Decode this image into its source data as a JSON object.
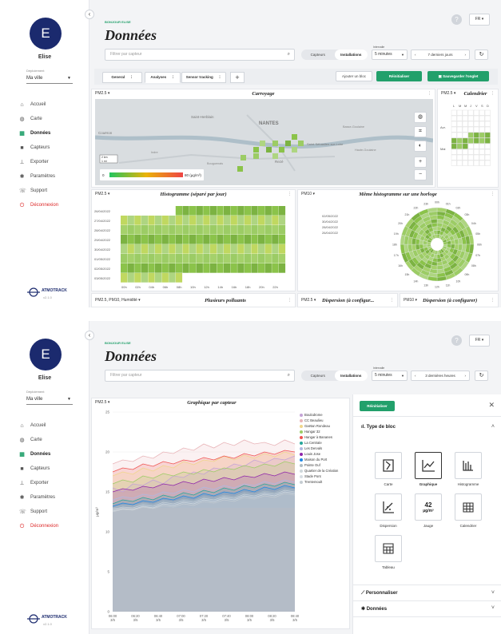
{
  "user": {
    "initial": "E",
    "name": "Elise",
    "deployment_label": "Déploiement",
    "deployment_value": "Ma ville"
  },
  "nav": [
    {
      "label": "Accueil",
      "icon": "home-icon"
    },
    {
      "label": "Carte",
      "icon": "globe-icon"
    },
    {
      "label": "Données",
      "icon": "grid-icon",
      "active": true
    },
    {
      "label": "Capteurs",
      "icon": "sensor-icon"
    },
    {
      "label": "Exporter",
      "icon": "download-icon"
    },
    {
      "label": "Paramètres",
      "icon": "gear-icon"
    },
    {
      "label": "Support",
      "icon": "support-icon"
    },
    {
      "label": "Déconnexion",
      "icon": "power-icon"
    }
  ],
  "brand": {
    "name": "ATMOTRACK",
    "version": "v2.1.0"
  },
  "header": {
    "greeting": "BONJOUR ELISE",
    "title": "Données",
    "help": "?",
    "lang": "FR ▾"
  },
  "toolbar": {
    "filter_placeholder": "Filtrer par capteur",
    "seg_sensors": "Capteurs",
    "seg_installations": "Installations",
    "interval_label": "Intervalle",
    "interval_value": "5 minutes",
    "range_1": "7 derniers jours",
    "range_2": "3 dernières heures"
  },
  "tabs": [
    {
      "label": "General"
    },
    {
      "label": "Analyses"
    },
    {
      "label": "Sensor tracking"
    }
  ],
  "actions": {
    "add_block": "Ajouter un bloc",
    "reset": "Réinitialiser",
    "save": "Sauvegarder l'onglet"
  },
  "screen1": {
    "map_panel": {
      "pollutant": "PM2.5 ▾",
      "title": "Carroyage",
      "legend_min": "0",
      "legend_max": "80 (µg/m³)",
      "scale_1": "2 km",
      "scale_2": "1 mi",
      "places": [
        "Saint-Herblain",
        "NANTES",
        "Couëron",
        "Saint-Sébastien-sur-Loire",
        "Rezé",
        "Basse-Goulaine",
        "Haute-Goulaine",
        "Bouguenais",
        "Indre"
      ]
    },
    "calendar_panel": {
      "pollutant": "PM2.5 ▾",
      "title": "Calendrier",
      "days": [
        "L",
        "M",
        "M",
        "J",
        "V",
        "S",
        "D"
      ],
      "months": [
        "Avr.",
        "Mai"
      ]
    },
    "histo_panel": {
      "pollutant": "PM2.5 ▾",
      "title": "Histogramme (séparé par jour)",
      "dates": [
        "26/04/2022",
        "27/04/2022",
        "28/04/2022",
        "29/04/2022",
        "30/04/2022",
        "01/05/2022",
        "02/05/2022",
        "03/05/2022"
      ],
      "hours": [
        "00h",
        "02h",
        "04h",
        "06h",
        "08h",
        "10h",
        "12h",
        "14h",
        "16h",
        "18h",
        "20h",
        "22h"
      ]
    },
    "clock_panel": {
      "pollutant": "PM10 ▾",
      "title": "Même histogramme sur une horloge",
      "dates": [
        "02/05/2022",
        "30/04/2022",
        "28/04/2022",
        "26/04/2022"
      ],
      "hours": [
        "22h",
        "23h",
        "00h",
        "01h",
        "02h",
        "03h",
        "04h",
        "05h",
        "06h",
        "07h",
        "08h",
        "09h",
        "10h",
        "11h",
        "12h",
        "13h",
        "14h",
        "15h",
        "16h",
        "17h",
        "18h",
        "19h",
        "20h",
        "21h"
      ]
    },
    "bottom_panels": [
      {
        "pollutant": "PM2.5, PM10, Humidité ▾",
        "title": "Plusieurs polluants"
      },
      {
        "pollutant": "PM2.5 ▾",
        "title": "Dispersion (à configur..."
      },
      {
        "pollutant": "PM10 ▾",
        "title": "Dispersion (à configurer)"
      }
    ]
  },
  "screen2": {
    "chart_panel": {
      "pollutant": "PM2.5 ▾",
      "title": "Graphique par capteur"
    },
    "side": {
      "section_type": "Type de bloc",
      "tiles": [
        {
          "label": "Carte",
          "icon": "map-icon"
        },
        {
          "label": "Graphique",
          "icon": "line-chart-icon",
          "selected": true
        },
        {
          "label": "Histogramme",
          "icon": "histogram-icon"
        },
        {
          "label": "Dispersion",
          "icon": "scatter-icon"
        },
        {
          "label": "Jauge",
          "icon": "gauge-icon",
          "value": "42",
          "unit": "µg/m³"
        },
        {
          "label": "Calendrier",
          "icon": "calendar-icon"
        },
        {
          "label": "Tableau",
          "icon": "table-icon"
        }
      ],
      "section_customize": "Personnaliser",
      "section_data": "Données"
    }
  },
  "chart_data": {
    "type": "line",
    "title": "Graphique par capteur",
    "ylabel": "µg/m³",
    "ylim": [
      0,
      25
    ],
    "yticks": [
      0,
      5,
      10,
      15,
      20,
      25
    ],
    "x": [
      "06:00\n3/5",
      "06:20\n3/5",
      "06:40\n3/5",
      "07:00\n3/5",
      "07:20\n3/5",
      "07:40\n3/5",
      "08:00\n3/5",
      "08:20\n3/5",
      "08:40\n3/5"
    ],
    "series": [
      {
        "name": "Boulodrome",
        "color": "#c4a3d6",
        "values": [
          15.5,
          15,
          16,
          15.8,
          16.5,
          16,
          17,
          16.8,
          17.5,
          17.2,
          18,
          17.8,
          18.5,
          18.2,
          19,
          18.6,
          19.2,
          19,
          19.5
        ]
      },
      {
        "name": "CC Beaulieu",
        "color": "#e8b4b8",
        "values": [
          18.5,
          19,
          18.8,
          19.5,
          19.2,
          20,
          19.8,
          20.5,
          20.2,
          21,
          20.5,
          21.2,
          20.8,
          21.5,
          21,
          21.2,
          20.8,
          21.5,
          21
        ]
      },
      {
        "name": "Gaëtan Rondeau",
        "color": "#f0d68a",
        "values": [
          17,
          17.5,
          17.2,
          18,
          17.6,
          18.3,
          18,
          18.8,
          18.4,
          19,
          18.8,
          19.5,
          19,
          19.6,
          19.2,
          19.8,
          19.4,
          20,
          19.6
        ]
      },
      {
        "name": "Hangar 32",
        "color": "#9ccc65",
        "values": [
          16,
          16.5,
          16.2,
          17,
          16.7,
          17.3,
          17,
          17.5,
          17.2,
          17.8,
          17.5,
          18,
          17.8,
          18.3,
          18,
          18.5,
          18.2,
          18.8,
          18.5
        ]
      },
      {
        "name": "Hangar à Bananes",
        "color": "#ef5350",
        "values": [
          17.5,
          18,
          17.8,
          18.5,
          18.2,
          18.8,
          18.5,
          19,
          18.8,
          19.3,
          19,
          19.5,
          19.2,
          19.8,
          19.5,
          20,
          19.7,
          20.2,
          20
        ]
      },
      {
        "name": "La Centrale",
        "color": "#26a69a",
        "values": [
          13.5,
          14,
          13.8,
          14.3,
          14,
          14.6,
          14.3,
          14.9,
          14.6,
          15.2,
          14.9,
          15.5,
          15.2,
          15.8,
          15.5,
          16,
          15.7,
          16.2,
          15.9
        ]
      },
      {
        "name": "Les Dervals",
        "color": "#b0b8e0",
        "values": [
          14,
          14.4,
          14.2,
          14.7,
          14.5,
          15,
          14.8,
          15.3,
          15,
          15.6,
          15.3,
          15.8,
          15.5,
          16,
          15.8,
          16.3,
          16,
          16.5,
          16.2
        ]
      },
      {
        "name": "Louis Jose",
        "color": "#8e24aa",
        "values": [
          15,
          15.4,
          15.2,
          15.7,
          15.5,
          16,
          15.8,
          16.3,
          16,
          16.6,
          16.3,
          16.8,
          16.5,
          17,
          16.8,
          17.3,
          17,
          17.5,
          17.2
        ]
      },
      {
        "name": "Maison du Port",
        "color": "#1e88e5",
        "values": [
          13.2,
          13.6,
          13.4,
          13.9,
          13.7,
          14.2,
          14,
          14.5,
          14.2,
          14.8,
          14.5,
          15,
          14.8,
          15.3,
          15,
          15.6,
          15.3,
          15.8,
          15.5
        ]
      },
      {
        "name": "Pointe Ouf",
        "color": "#b0bec5",
        "values": [
          13,
          13.3,
          13.2,
          13.6,
          13.4,
          13.9,
          13.7,
          14.1,
          13.9,
          14.4,
          14.2,
          14.6,
          14.4,
          14.9,
          14.7,
          15.1,
          14.9,
          15.4,
          15.2
        ]
      },
      {
        "name": "Quartier de la Création",
        "color": "#cfd8dc",
        "values": [
          12.8,
          13.1,
          13,
          13.4,
          13.2,
          13.7,
          13.5,
          13.9,
          13.7,
          14.2,
          14,
          14.4,
          14.2,
          14.7,
          14.5,
          14.9,
          14.7,
          15.2,
          15
        ]
      },
      {
        "name": "Stade Pont",
        "color": "#d7dee3",
        "values": [
          12.6,
          12.9,
          12.8,
          13.2,
          13,
          13.5,
          13.3,
          13.7,
          13.5,
          14,
          13.8,
          14.2,
          14,
          14.5,
          14.3,
          14.7,
          14.5,
          15,
          14.8
        ]
      },
      {
        "name": "Trentemoult",
        "color": "#c5ccd2",
        "values": [
          12.5,
          12.8,
          12.7,
          13.1,
          12.9,
          13.3,
          13.1,
          13.5,
          13.3,
          13.8,
          13.6,
          14,
          13.8,
          14.3,
          14.1,
          14.5,
          14.3,
          14.8,
          14.6
        ]
      }
    ]
  }
}
